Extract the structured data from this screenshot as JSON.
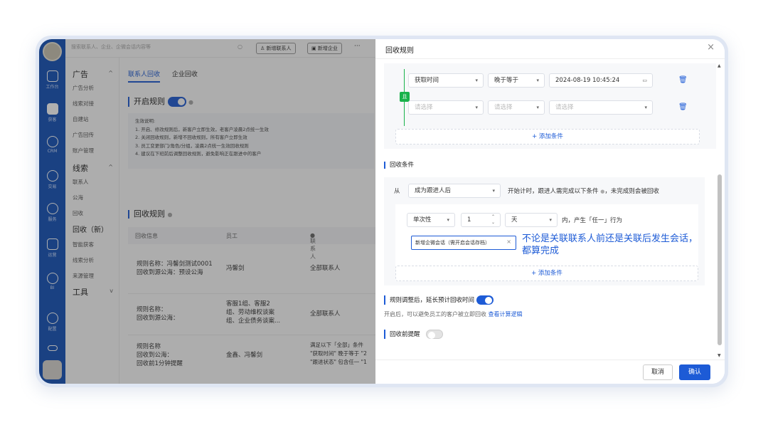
{
  "nav": {
    "items": [
      {
        "icon": "workbench-icon",
        "label": "工作台"
      },
      {
        "icon": "leads-icon",
        "label": "获客"
      },
      {
        "icon": "user-icon",
        "label": "CRM"
      },
      {
        "icon": "yen-icon",
        "label": "交易"
      },
      {
        "icon": "chat-icon",
        "label": "服务"
      },
      {
        "icon": "chart-icon",
        "label": "运营"
      },
      {
        "icon": "pie-icon",
        "label": "BI"
      },
      {
        "icon": "gear-icon",
        "label": "配置"
      },
      {
        "icon": "link-icon",
        "label": ""
      }
    ]
  },
  "topbar": {
    "search_placeholder": "搜索联系人、企业、企微会话内容等",
    "add_contact": "新增联系人",
    "add_company": "新增企业",
    "more": "···"
  },
  "sidebar": {
    "groups": [
      {
        "title": "广告",
        "items": [
          "广告分析",
          "线索对接",
          "自建站",
          "广告回传",
          "账户管理"
        ]
      },
      {
        "title": "线索",
        "items": [
          "联系人",
          "公海",
          "回收",
          "回收（新）",
          "智能获客",
          "线索分析",
          "来源管理"
        ]
      },
      {
        "title": "工具",
        "items": []
      }
    ]
  },
  "main": {
    "tabs": [
      "联系人回收",
      "企业回收"
    ],
    "enable_rule_title": "开启规则",
    "info_lines": [
      "生效说明:",
      "1. 开启、修改规则后，新客户立即生效，老客户凌晨2点统一生效",
      "2. 关闭回收规则，新增不回收规则，所有客户立即生效",
      "3. 员工变更部门/角色/分组，凌晨2点统一生效回收规则",
      "4. 建议在下班前后调整回收规则，避免影响正在跟进中的客户"
    ],
    "recycle_rules_title": "回收规则",
    "table_headers": [
      "回收信息",
      "员工",
      "联系人"
    ],
    "rows": [
      {
        "info": [
          "规则名称：冯馨剑测试0001",
          "回收到源公海：预设公海"
        ],
        "staff": [
          "冯馨剑"
        ],
        "contact": [
          "全部联系人"
        ]
      },
      {
        "info": [
          "规则名称：",
          "回收到源公海："
        ],
        "staff": [
          "客服1组、客服2",
          "组、劳动维权谈案",
          "组、企业债务谈案..."
        ],
        "contact": [
          "全部联系人"
        ]
      },
      {
        "info": [
          "规则名称",
          "回收到公海：",
          "回收前1分钟提醒"
        ],
        "staff": [
          "金鑫、冯馨剑"
        ],
        "contact": [
          "满足以下「全部」条件",
          "\"获取时间\" 晚于等于 \"2",
          "\"跟进状态\" 包含任一 \"1"
        ]
      }
    ]
  },
  "drawer": {
    "title": "回收规则",
    "close": "×",
    "and_label": "且",
    "cond1": {
      "field": "获取时间",
      "op": "晚于等于",
      "value": "2024-08-19 10:45:24"
    },
    "cond2": {
      "field": "请选择",
      "op": "请选择",
      "value": "请选择"
    },
    "add_condition": "+ 添加条件",
    "recycle_cond_title": "回收条件",
    "from_label": "从",
    "from_value": "成为跟进人后",
    "from_suffix": "开始计时，跟进人需完成以下条件",
    "from_suffix2": "，未完成则会被回收",
    "freq": "单次性",
    "num": "1",
    "unit": "天",
    "within": "内，产生「任一」行为",
    "tag": "新增企微会话（需开启会话存档）",
    "tag_close": "×",
    "note_line1": "不论是关联联系人前还是关联后发生会话，",
    "note_line2": "都算完成",
    "extend_title": "规则调整后，延长预计回收时间",
    "extend_desc": "开启后，可以避免员工的客户被立即回收",
    "extend_link": "查看计算逻辑",
    "remind_title": "回收前提醒",
    "cancel": "取消",
    "confirm": "确认"
  }
}
